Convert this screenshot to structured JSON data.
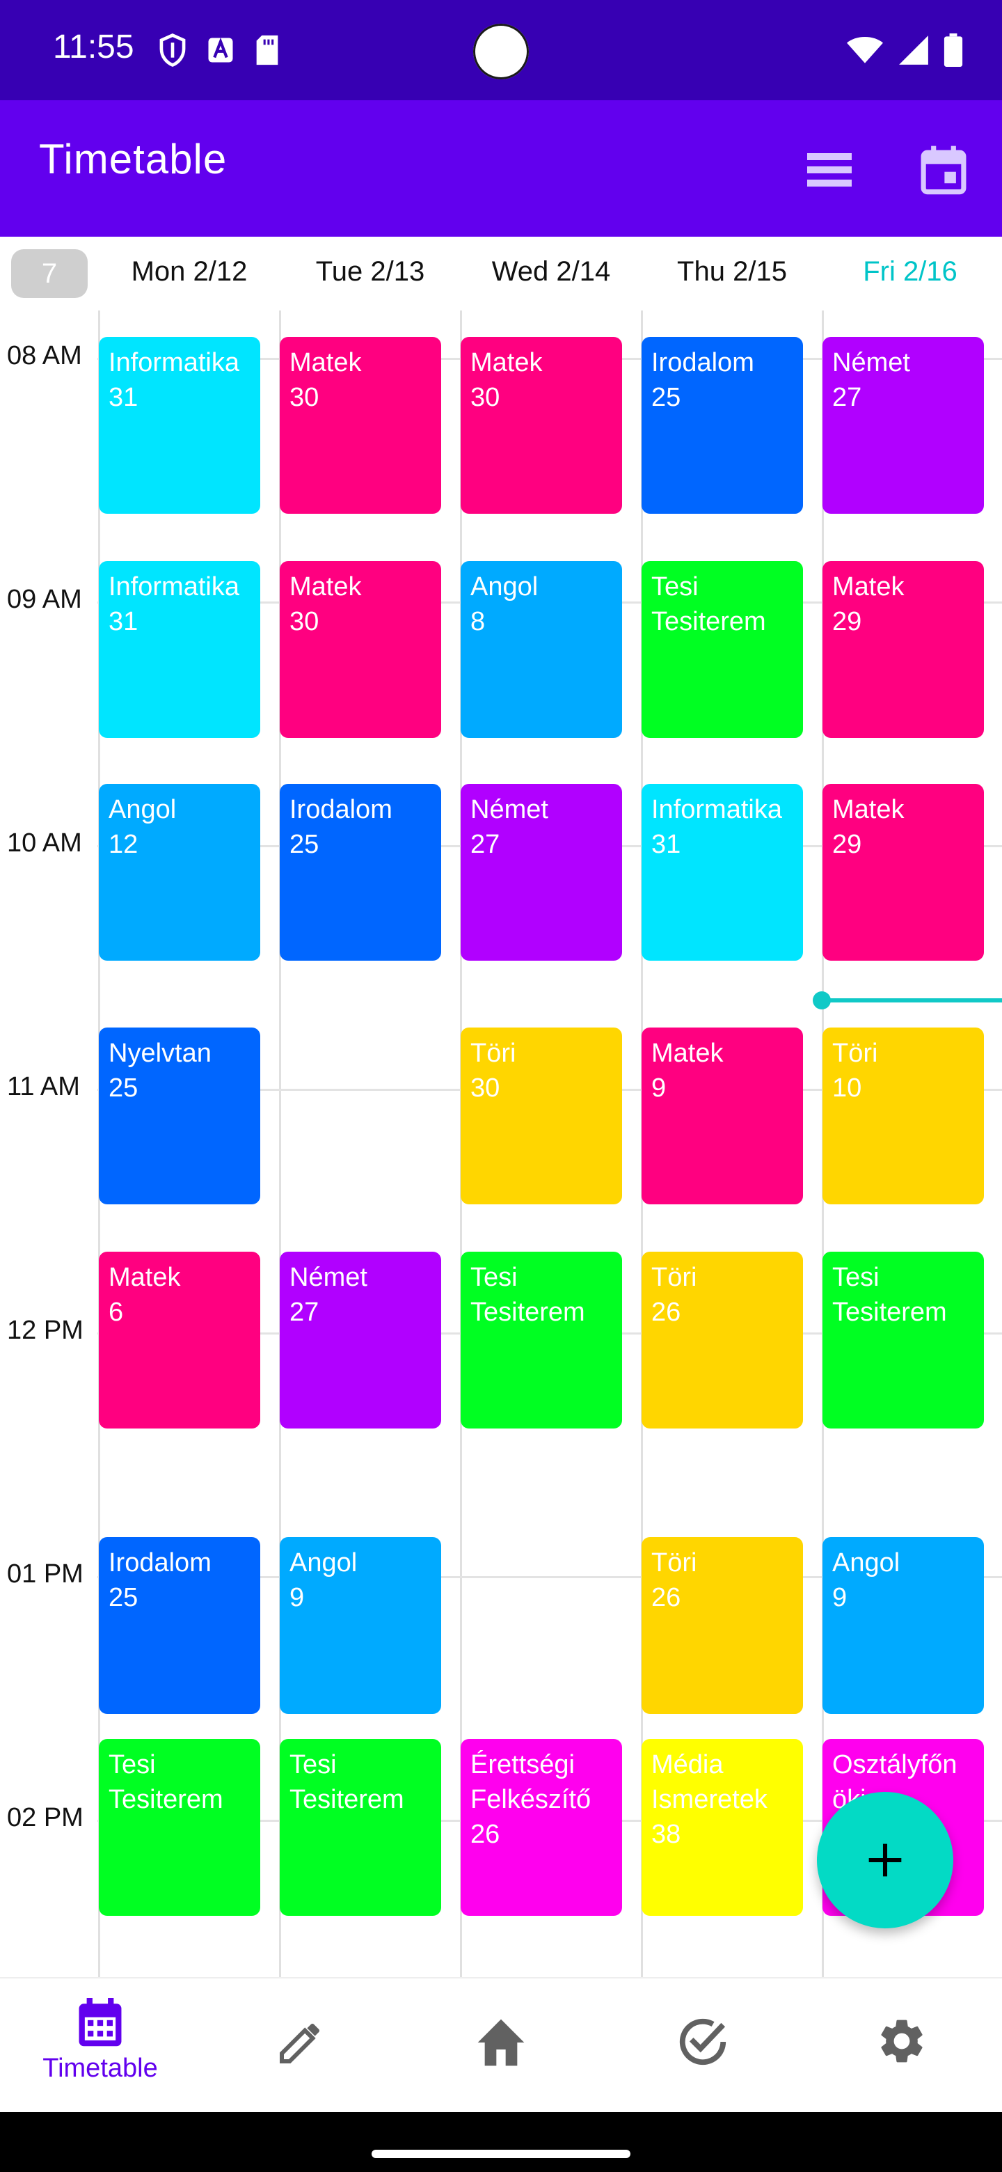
{
  "status_bar": {
    "time": "11:55"
  },
  "app_bar": {
    "title": "Timetable"
  },
  "header": {
    "week_number": "7",
    "days": [
      "Mon 2/12",
      "Tue 2/13",
      "Wed 2/14",
      "Thu 2/15",
      "Fri 2/16"
    ],
    "today_index": 4
  },
  "time_labels": [
    "08 AM",
    "09 AM",
    "10 AM",
    "11 AM",
    "12 PM",
    "01 PM",
    "02 PM"
  ],
  "colors": {
    "Informatika": "#00e5ff",
    "Matek": "#ff0080",
    "Irodalom": "#0066ff",
    "Nemet": "#b100ff",
    "Angol": "#00aaff",
    "Tesi": "#00ff22",
    "Nyelvtan": "#0066ff",
    "Tori": "#ffd600",
    "Erettsegi": "#ff00ee",
    "Media": "#ffff00",
    "Osztalyfonoki": "#ff00ee",
    "status_bar": "#3700b3",
    "app_bar": "#6200ee",
    "accent": "#03dac5"
  },
  "events": {
    "mon_08": {
      "name": "Informatika",
      "room": "31"
    },
    "tue_08": {
      "name": "Matek",
      "room": "30"
    },
    "wed_08": {
      "name": "Matek",
      "room": "30"
    },
    "thu_08": {
      "name": "Irodalom",
      "room": "25"
    },
    "fri_08": {
      "name": "Német",
      "room": "27"
    },
    "mon_09": {
      "name": "Informatika",
      "room": "31"
    },
    "tue_09": {
      "name": "Matek",
      "room": "30"
    },
    "wed_09": {
      "name": "Angol",
      "room": "8"
    },
    "thu_09": {
      "name": "Tesi",
      "room": "Tesiterem"
    },
    "fri_09": {
      "name": "Matek",
      "room": "29"
    },
    "mon_10": {
      "name": "Angol",
      "room": "12"
    },
    "tue_10": {
      "name": "Irodalom",
      "room": "25"
    },
    "wed_10": {
      "name": "Német",
      "room": "27"
    },
    "thu_10": {
      "name": "Informatika",
      "room": "31"
    },
    "fri_10": {
      "name": "Matek",
      "room": "29"
    },
    "mon_11": {
      "name": "Nyelvtan",
      "room": "25"
    },
    "wed_11": {
      "name": "Töri",
      "room": "30"
    },
    "thu_11": {
      "name": "Matek",
      "room": "9"
    },
    "fri_11": {
      "name": "Töri",
      "room": "10"
    },
    "mon_12": {
      "name": "Matek",
      "room": "6"
    },
    "tue_12": {
      "name": "Német",
      "room": "27"
    },
    "wed_12": {
      "name": "Tesi",
      "room": "Tesiterem"
    },
    "thu_12": {
      "name": "Töri",
      "room": "26"
    },
    "fri_12": {
      "name": "Tesi",
      "room": "Tesiterem"
    },
    "mon_13": {
      "name": "Irodalom",
      "room": "25"
    },
    "tue_13": {
      "name": "Angol",
      "room": "9"
    },
    "thu_13": {
      "name": "Töri",
      "room": "26"
    },
    "fri_13": {
      "name": "Angol",
      "room": "9"
    },
    "mon_14": {
      "name": "Tesi",
      "room": "Tesiterem"
    },
    "tue_14": {
      "name": "Tesi",
      "room": "Tesiterem"
    },
    "wed_14": {
      "name": "Érettségi",
      "line2": "Felkészítő",
      "room": "26"
    },
    "thu_14": {
      "name": "Média",
      "line2": "Ismeretek",
      "room": "38"
    },
    "fri_14": {
      "name": "Osztályfőn",
      "line2": "öki"
    }
  },
  "bottom_nav": {
    "timetable_label": "Timetable"
  }
}
